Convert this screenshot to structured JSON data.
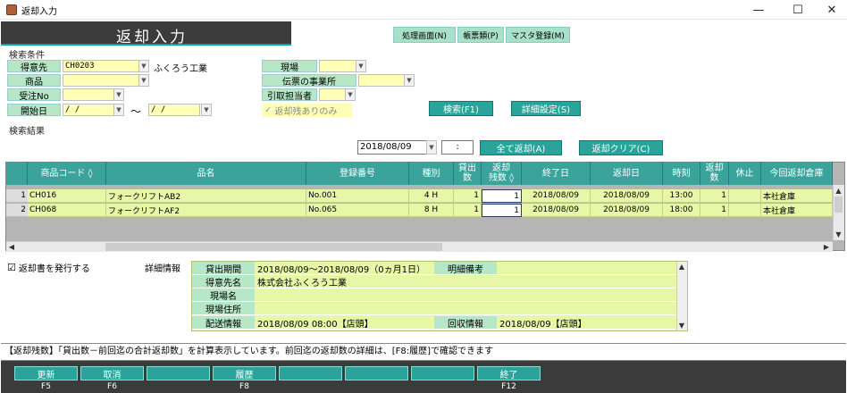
{
  "window": {
    "title": "返却入力",
    "minimize": "—",
    "maximize": "☐",
    "close": "✕",
    "icon": "app-icon"
  },
  "header": {
    "title": "返却入力",
    "menus": [
      "処理画面(N)",
      "帳票類(P)",
      "マスタ登録(M)"
    ]
  },
  "search": {
    "section_label": "検索条件",
    "tokuisaki_label": "得意先",
    "tokuisaki_code": "CH0203",
    "tokuisaki_name": "ふくろう工業",
    "shohin_label": "商品",
    "juchu_label": "受注No",
    "kaishi_label": "開始日",
    "date_from": "  /  /",
    "tilde": "〜",
    "date_to": "  /  /",
    "genba_label": "現場",
    "denpyo_label": "伝票の事業所",
    "hikitori_label": "引取担当者",
    "henkyaku_only_label": "返却残ありのみ",
    "henkyaku_only_checked": "✓",
    "search_button": "検索(F1)",
    "detail_button": "詳細設定(S)"
  },
  "result": {
    "section_label": "検索結果",
    "date_value": "2018/08/09",
    "time_value": ":",
    "all_return_button": "全て返却(A)",
    "return_clear_button": "返却クリア(C)",
    "columns": [
      "",
      "商品コード ◊",
      "品名",
      "登録番号",
      "種別",
      "貸出\n数",
      "返却\n残数 ◊",
      "終了日",
      "返却日",
      "時刻",
      "返却\n数",
      "休止",
      "今回返却倉庫"
    ],
    "rows": [
      [
        "1",
        "CH016",
        "フォークリフトAB2",
        "No.001",
        "4 H",
        "1",
        "1",
        "2018/08/09",
        "2018/08/09",
        "13:00",
        "1",
        "",
        "本社倉庫"
      ],
      [
        "2",
        "CH068",
        "フォークリフトAF2",
        "No.065",
        "8 H",
        "1",
        "1",
        "2018/08/09",
        "2018/08/09",
        "18:00",
        "1",
        "",
        "本社倉庫"
      ]
    ]
  },
  "detail": {
    "issue_label": "返却書を発行する",
    "issue_checked": "☑",
    "section_label": "詳細情報",
    "kashidashi_label": "貸出期間",
    "kashidashi_value": "2018/08/09〜2018/08/09（0ヵ月1日）",
    "meisai_label": "明細備考",
    "tokuisaki_label": "得意先名",
    "tokuisaki_value": "株式会社ふくろう工業",
    "genba_label": "現場名",
    "genba_address_label": "現場住所",
    "haiso_label": "配送情報",
    "haiso_value": "2018/08/09 08:00【店頭】",
    "kaishu_label": "回収情報",
    "kaishu_value": "2018/08/09【店頭】"
  },
  "status": {
    "text": "【返却残数】「貸出数－前回迄の合計返却数」を計算表示しています。前回迄の返却数の詳細は、[F8:履歴]で確認できます"
  },
  "fkeys": [
    {
      "label": "更新",
      "key": "F5"
    },
    {
      "label": "取消",
      "key": "F6"
    },
    {
      "label": "",
      "key": ""
    },
    {
      "label": "履歴",
      "key": "F8"
    },
    {
      "label": "",
      "key": ""
    },
    {
      "label": "",
      "key": ""
    },
    {
      "label": "",
      "key": ""
    },
    {
      "label": "終了",
      "key": "F12"
    }
  ]
}
